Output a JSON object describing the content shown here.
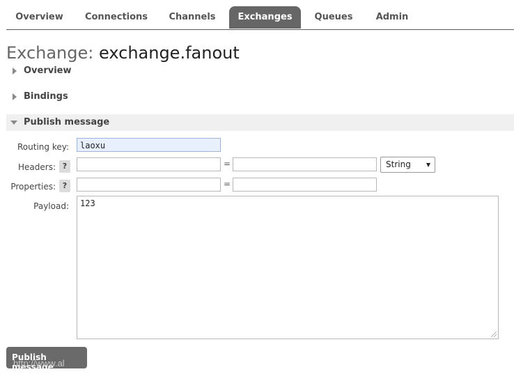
{
  "nav": {
    "tabs": [
      {
        "label": "Overview"
      },
      {
        "label": "Connections"
      },
      {
        "label": "Channels"
      },
      {
        "label": "Exchanges"
      },
      {
        "label": "Queues"
      },
      {
        "label": "Admin"
      }
    ],
    "active_tab": "Exchanges"
  },
  "header": {
    "prefix": "Exchange:",
    "name": "exchange.fanout"
  },
  "sections": {
    "overview": "Overview",
    "bindings": "Bindings",
    "publish": "Publish message"
  },
  "form": {
    "routing_key_label": "Routing key:",
    "routing_key_value": "laoxu",
    "headers_label": "Headers:",
    "properties_label": "Properties:",
    "payload_label": "Payload:",
    "payload_value": "123",
    "help_glyph": "?",
    "equals": "=",
    "header_type": "String"
  },
  "actions": {
    "publish_button": "Publish message"
  },
  "watermark": "http://www.al",
  "colors": {
    "active_tab_bg": "#666666",
    "button_bg": "#6a6a6a",
    "filled_input_bg": "#e8f0fe"
  }
}
